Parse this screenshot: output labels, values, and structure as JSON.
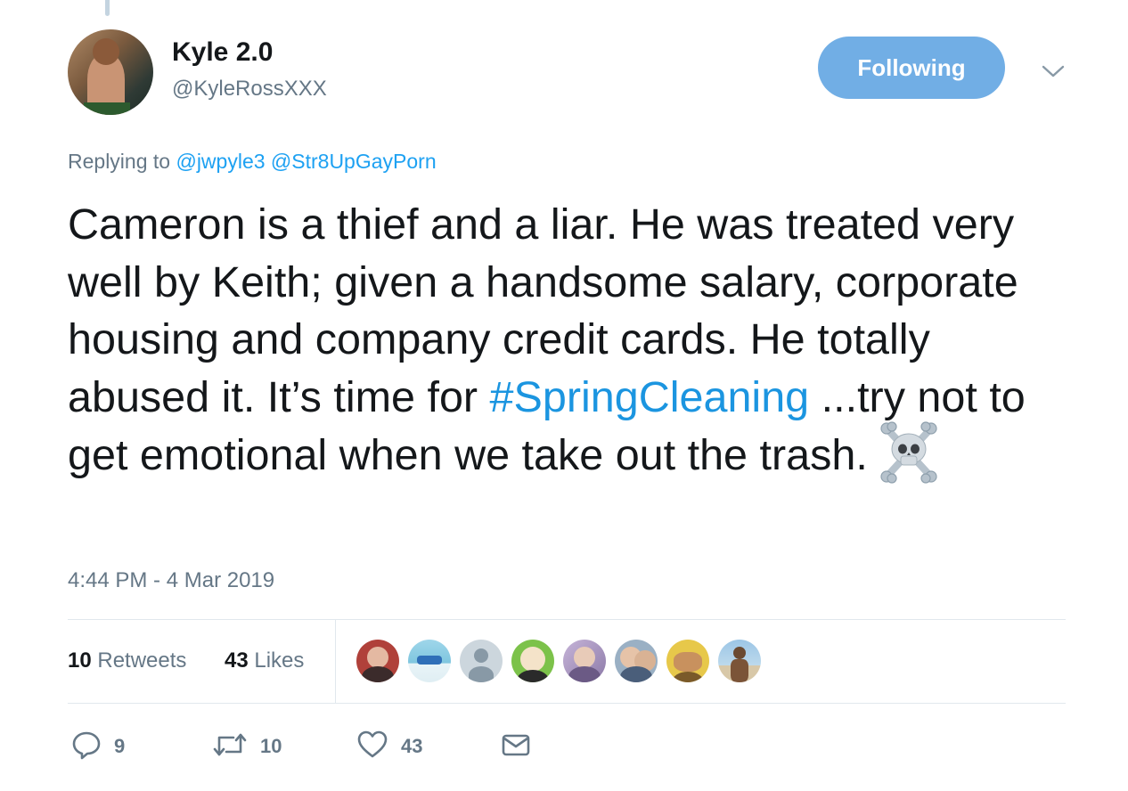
{
  "tweet": {
    "author": {
      "display_name": "Kyle 2.0",
      "handle": "@KyleRossXXX"
    },
    "follow_button_label": "Following",
    "replying_prefix": "Replying to",
    "replying_to": [
      "@jwpyle3",
      "@Str8UpGayPorn"
    ],
    "text_before_hashtag": "Cameron is a thief and a liar. He was treated very well by Keith; given a handsome salary, corporate housing and company credit cards. He totally abused it. It’s time for ",
    "hashtag": "#SpringCleaning",
    "text_after_hashtag": " ...try not to get emotional when we take out the trash.",
    "emoji": "skull-and-crossbones",
    "timestamp": "4:44 PM - 4 Mar 2019",
    "stats": {
      "retweets_count": "10",
      "retweets_label": "Retweets",
      "likes_count": "43",
      "likes_label": "Likes"
    },
    "likers_shown": 8,
    "actions": {
      "reply_count": "9",
      "retweet_count": "10",
      "like_count": "43"
    }
  },
  "colors": {
    "follow_button": "#71aee5",
    "link": "#1b95e0",
    "secondary_text": "#657786",
    "divider": "#e1e8ed"
  }
}
